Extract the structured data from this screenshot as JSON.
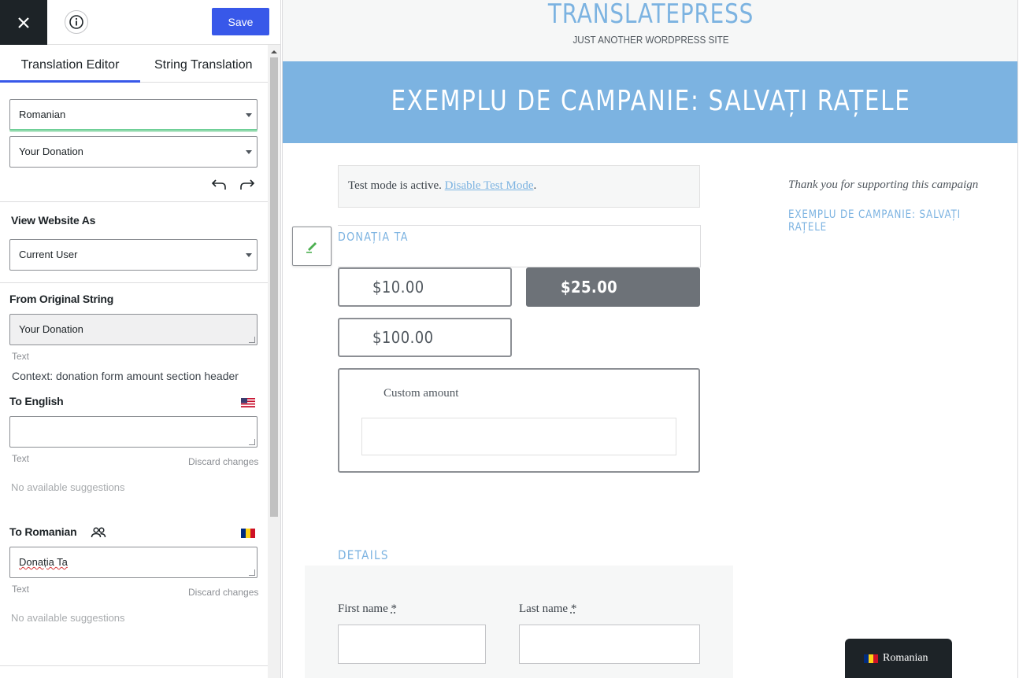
{
  "toolbar": {
    "close_icon": "close-icon",
    "info_icon": "info-icon",
    "save_label": "Save"
  },
  "tabs": [
    {
      "label": "Translation Editor",
      "active": true
    },
    {
      "label": "String Translation",
      "active": false
    }
  ],
  "language_select": {
    "value": "Romanian"
  },
  "string_select": {
    "value": "Your Donation"
  },
  "view_as": {
    "label": "View Website As",
    "value": "Current User"
  },
  "original": {
    "label": "From Original String",
    "value": "Your Donation",
    "type": "Text",
    "context": "Context: donation form amount section header"
  },
  "to_english": {
    "label": "To English",
    "value": "",
    "type": "Text",
    "discard": "Discard changes",
    "suggestions": "No available suggestions"
  },
  "to_romanian": {
    "label": "To Romanian",
    "value": "Donația Ta",
    "type": "Text",
    "discard": "Discard changes",
    "suggestions": "No available suggestions"
  },
  "colors": {
    "accent": "#3858e9",
    "site_blue": "#7cb3e1",
    "dark": "#1d2327"
  },
  "site": {
    "title": "TRANSLATEPRESS",
    "tagline": "JUST ANOTHER WORDPRESS SITE",
    "banner_title": "EXEMPLU DE CAMPANIE: SALVAȚI RAȚELE",
    "test_mode_text": "Test mode is active.",
    "test_mode_link": "Disable Test Mode",
    "test_mode_suffix": ".",
    "donation_heading": "DONAȚIA TA",
    "amounts": [
      "$10.00",
      "$25.00",
      "$100.00"
    ],
    "selected_amount": "$25.00",
    "custom_amount_label": "Custom amount",
    "details_heading": "DETAILS",
    "first_name_label": "First name",
    "last_name_label": "Last name",
    "required_mark": "*",
    "sidebar_thanks": "Thank you for supporting this campaign",
    "sidebar_campaign": "EXEMPLU DE CAMPANIE: SALVAȚI RAȚELE",
    "language_switcher": "Romanian"
  }
}
